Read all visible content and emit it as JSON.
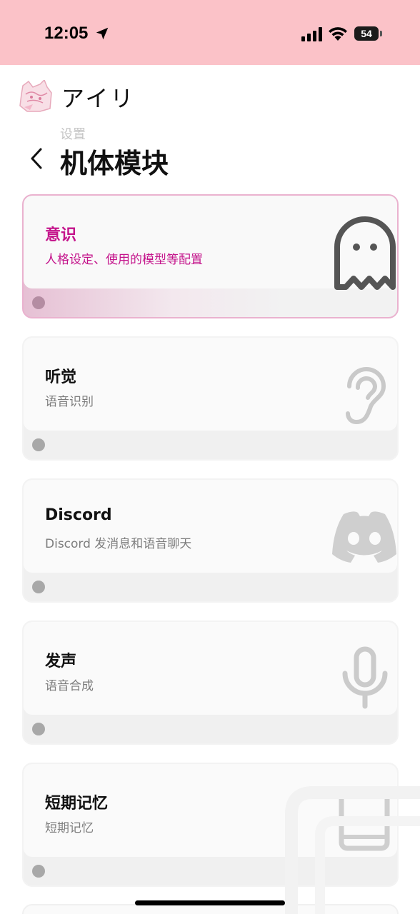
{
  "status_bar": {
    "time": "12:05",
    "battery": "54",
    "icons": [
      "location-arrow-icon",
      "cellular-signal-icon",
      "wifi-icon",
      "battery-icon"
    ]
  },
  "header": {
    "app_name": "アイリ",
    "breadcrumb": "设置",
    "title": "机体模块"
  },
  "modules": [
    {
      "title": "意识",
      "description": "人格设定、使用的模型等配置",
      "icon": "ghost-icon",
      "active": true
    },
    {
      "title": "听觉",
      "description": "语音识别",
      "icon": "ear-icon",
      "active": false
    },
    {
      "title": "Discord",
      "description": "Discord 发消息和语音聊天",
      "icon": "discord-icon",
      "active": false
    },
    {
      "title": "发声",
      "description": "语音合成",
      "icon": "microphone-icon",
      "active": false
    },
    {
      "title": "短期记忆",
      "description": "短期记忆",
      "icon": "book-icon",
      "active": false
    }
  ],
  "colors": {
    "status_bar_bg": "#fbc2c8",
    "accent": "#c4148b",
    "active_border": "#eab2cf"
  }
}
